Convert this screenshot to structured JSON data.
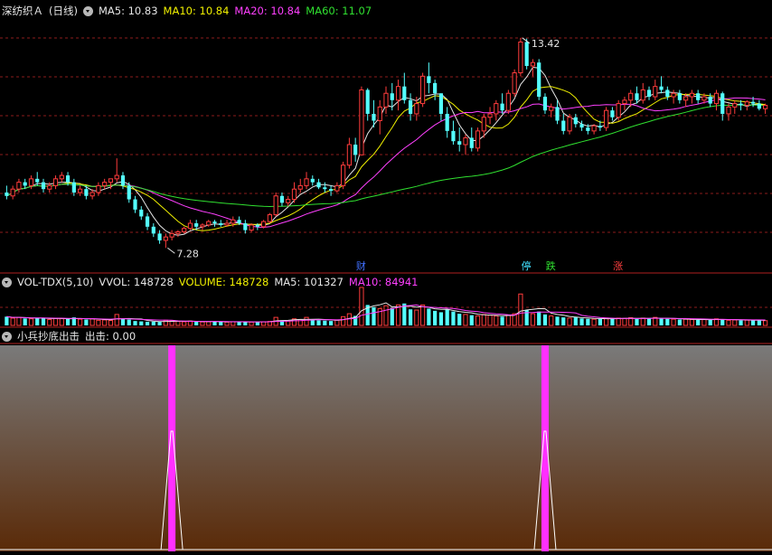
{
  "price_panel": {
    "stock": "深纺织Ａ",
    "period": "(日线)",
    "ma_labels": [
      {
        "text": "MA5: 10.83",
        "color": "#e6e6e6"
      },
      {
        "text": "MA10: 10.84",
        "color": "#f0f000"
      },
      {
        "text": "MA20: 10.84",
        "color": "#ff40ff"
      },
      {
        "text": "MA60: 11.07",
        "color": "#30e030"
      }
    ],
    "high_label": "13.42",
    "low_label": "7.28",
    "event_markers": [
      {
        "text": "财",
        "color": "#4070ff"
      },
      {
        "text": "停",
        "color": "#40e0ff"
      },
      {
        "text": "跌",
        "color": "#30e030"
      },
      {
        "text": "涨",
        "color": "#ff4040"
      }
    ]
  },
  "volume_panel": {
    "name": "VOL-TDX(5,10)",
    "labels": [
      {
        "text": "VVOL: 148728",
        "color": "#e6e6e6"
      },
      {
        "text": "VOLUME: 148728",
        "color": "#f0f000"
      },
      {
        "text": "MA5: 101327",
        "color": "#e6e6e6"
      },
      {
        "text": "MA10: 84941",
        "color": "#ff40ff"
      }
    ]
  },
  "indicator_panel": {
    "name": "小兵抄底出击",
    "label": "出击: 0.00"
  },
  "colors": {
    "up": "#ff3c3c",
    "down": "#54ffff",
    "grid": "#8c1c1c",
    "spike": "#ff30ff"
  },
  "chart_data": [
    {
      "type": "candlestick",
      "title": "深纺织Ａ (日线)",
      "ylim": [
        6.6,
        14.0
      ],
      "candles": [
        [
          8.9,
          9.1,
          8.7,
          8.8
        ],
        [
          8.8,
          9.1,
          8.7,
          9.0
        ],
        [
          9.0,
          9.3,
          8.9,
          9.2
        ],
        [
          9.2,
          9.3,
          9.0,
          9.1
        ],
        [
          9.1,
          9.4,
          9.0,
          9.3
        ],
        [
          9.3,
          9.5,
          9.1,
          9.2
        ],
        [
          9.2,
          9.3,
          8.9,
          9.0
        ],
        [
          9.0,
          9.2,
          8.9,
          9.1
        ],
        [
          9.1,
          9.4,
          9.0,
          9.3
        ],
        [
          9.3,
          9.5,
          9.2,
          9.4
        ],
        [
          9.4,
          9.5,
          9.1,
          9.2
        ],
        [
          9.2,
          9.3,
          8.8,
          8.9
        ],
        [
          8.9,
          9.1,
          8.8,
          9.0
        ],
        [
          9.0,
          9.1,
          8.7,
          8.8
        ],
        [
          8.8,
          9.0,
          8.7,
          8.9
        ],
        [
          8.9,
          9.2,
          8.8,
          9.1
        ],
        [
          9.1,
          9.3,
          9.0,
          9.2
        ],
        [
          9.2,
          9.3,
          9.0,
          9.3
        ],
        [
          9.3,
          9.9,
          9.2,
          9.4
        ],
        [
          9.4,
          9.5,
          9.0,
          9.1
        ],
        [
          9.1,
          9.2,
          8.6,
          8.7
        ],
        [
          8.7,
          8.8,
          8.3,
          8.4
        ],
        [
          8.4,
          8.5,
          8.1,
          8.2
        ],
        [
          8.2,
          8.3,
          7.8,
          7.9
        ],
        [
          7.9,
          8.0,
          7.6,
          7.7
        ],
        [
          7.7,
          7.8,
          7.4,
          7.5
        ],
        [
          7.5,
          7.7,
          7.28,
          7.6
        ],
        [
          7.6,
          7.8,
          7.5,
          7.7
        ],
        [
          7.7,
          7.8,
          7.6,
          7.75
        ],
        [
          7.75,
          7.9,
          7.7,
          7.85
        ],
        [
          7.85,
          8.1,
          7.8,
          8.0
        ],
        [
          8.0,
          8.1,
          7.8,
          7.9
        ],
        [
          7.9,
          8.0,
          7.8,
          7.95
        ],
        [
          7.95,
          8.1,
          7.9,
          8.05
        ],
        [
          8.05,
          8.1,
          7.9,
          8.0
        ],
        [
          8.0,
          8.1,
          7.9,
          7.95
        ],
        [
          7.95,
          8.1,
          7.9,
          8.0
        ],
        [
          8.0,
          8.2,
          7.9,
          8.1
        ],
        [
          8.1,
          8.2,
          7.95,
          8.0
        ],
        [
          8.0,
          8.1,
          7.7,
          7.8
        ],
        [
          7.8,
          8.0,
          7.75,
          7.95
        ],
        [
          7.95,
          8.0,
          7.8,
          7.9
        ],
        [
          7.9,
          8.1,
          7.85,
          8.05
        ],
        [
          8.05,
          8.3,
          8.0,
          8.25
        ],
        [
          8.25,
          8.9,
          8.2,
          8.8
        ],
        [
          8.8,
          8.9,
          8.5,
          8.6
        ],
        [
          8.6,
          8.8,
          8.5,
          8.7
        ],
        [
          8.7,
          9.2,
          8.6,
          9.0
        ],
        [
          9.0,
          9.3,
          8.9,
          9.1
        ],
        [
          9.1,
          9.5,
          9.0,
          9.3
        ],
        [
          9.3,
          9.4,
          9.1,
          9.2
        ],
        [
          9.2,
          9.3,
          9.0,
          9.05
        ],
        [
          9.05,
          9.2,
          8.9,
          9.0
        ],
        [
          9.0,
          9.1,
          8.8,
          8.95
        ],
        [
          8.95,
          9.2,
          8.9,
          9.1
        ],
        [
          9.1,
          9.8,
          9.0,
          9.7
        ],
        [
          9.7,
          10.5,
          9.6,
          10.3
        ],
        [
          10.3,
          10.5,
          9.8,
          10.0
        ],
        [
          10.0,
          12.0,
          10.0,
          11.9
        ],
        [
          11.9,
          11.95,
          11.0,
          11.2
        ],
        [
          11.2,
          11.6,
          10.8,
          11.0
        ],
        [
          11.0,
          11.6,
          10.6,
          11.4
        ],
        [
          11.4,
          12.0,
          11.2,
          11.8
        ],
        [
          11.8,
          12.1,
          11.3,
          11.6
        ],
        [
          11.6,
          12.2,
          11.3,
          12.0
        ],
        [
          12.0,
          12.4,
          11.5,
          11.6
        ],
        [
          11.6,
          11.8,
          11.0,
          11.2
        ],
        [
          11.2,
          11.7,
          11.0,
          11.5
        ],
        [
          11.5,
          12.4,
          11.4,
          12.3
        ],
        [
          12.3,
          12.7,
          11.8,
          12.1
        ],
        [
          12.1,
          12.2,
          11.6,
          11.8
        ],
        [
          11.8,
          11.8,
          11.0,
          11.2
        ],
        [
          11.2,
          11.4,
          10.5,
          10.7
        ],
        [
          10.7,
          11.0,
          10.3,
          10.4
        ],
        [
          10.4,
          10.8,
          10.1,
          10.3
        ],
        [
          10.3,
          10.6,
          10.0,
          10.5
        ],
        [
          10.5,
          10.8,
          10.1,
          10.2
        ],
        [
          10.2,
          10.8,
          10.1,
          10.7
        ],
        [
          10.7,
          11.2,
          10.5,
          11.1
        ],
        [
          11.1,
          11.4,
          10.9,
          11.2
        ],
        [
          11.2,
          11.6,
          11.0,
          11.5
        ],
        [
          11.5,
          11.8,
          11.2,
          11.3
        ],
        [
          11.3,
          11.9,
          11.2,
          11.8
        ],
        [
          11.8,
          12.5,
          11.7,
          12.4
        ],
        [
          12.4,
          13.42,
          12.3,
          13.3
        ],
        [
          13.3,
          13.4,
          12.5,
          12.6
        ],
        [
          12.6,
          12.8,
          12.3,
          12.7
        ],
        [
          12.7,
          12.8,
          11.6,
          11.7
        ],
        [
          11.7,
          11.8,
          11.2,
          11.3
        ],
        [
          11.3,
          11.5,
          11.1,
          11.4
        ],
        [
          11.4,
          11.6,
          10.9,
          11.0
        ],
        [
          11.0,
          11.2,
          10.6,
          10.7
        ],
        [
          10.7,
          11.2,
          10.6,
          11.1
        ],
        [
          11.1,
          11.2,
          10.8,
          10.9
        ],
        [
          10.9,
          11.0,
          10.7,
          10.8
        ],
        [
          10.8,
          10.9,
          10.6,
          10.7
        ],
        [
          10.7,
          10.9,
          10.6,
          10.85
        ],
        [
          10.85,
          11.0,
          10.7,
          10.8
        ],
        [
          10.8,
          11.4,
          10.7,
          11.3
        ],
        [
          11.3,
          11.4,
          11.0,
          11.1
        ],
        [
          11.1,
          11.6,
          11.0,
          11.5
        ],
        [
          11.5,
          11.7,
          11.3,
          11.6
        ],
        [
          11.6,
          11.9,
          11.4,
          11.8
        ],
        [
          11.8,
          12.0,
          11.5,
          11.6
        ],
        [
          11.6,
          12.1,
          11.5,
          11.9
        ],
        [
          11.9,
          12.0,
          11.6,
          11.7
        ],
        [
          11.7,
          12.2,
          11.6,
          12.0
        ],
        [
          12.0,
          12.3,
          11.8,
          11.9
        ],
        [
          11.9,
          12.0,
          11.6,
          11.7
        ],
        [
          11.7,
          11.9,
          11.5,
          11.8
        ],
        [
          11.8,
          11.9,
          11.5,
          11.6
        ],
        [
          11.6,
          11.8,
          11.4,
          11.7
        ],
        [
          11.7,
          11.9,
          11.5,
          11.8
        ],
        [
          11.8,
          11.9,
          11.5,
          11.6
        ],
        [
          11.6,
          11.8,
          11.5,
          11.7
        ],
        [
          11.7,
          11.8,
          11.4,
          11.5
        ],
        [
          11.5,
          11.9,
          11.3,
          11.8
        ],
        [
          11.8,
          11.85,
          11.0,
          11.2
        ],
        [
          11.2,
          11.5,
          11.0,
          11.4
        ],
        [
          11.4,
          11.6,
          11.2,
          11.5
        ],
        [
          11.5,
          11.6,
          11.3,
          11.45
        ],
        [
          11.45,
          11.6,
          11.3,
          11.55
        ],
        [
          11.55,
          11.7,
          11.4,
          11.5
        ],
        [
          11.5,
          11.6,
          11.3,
          11.35
        ],
        [
          11.35,
          11.5,
          11.2,
          11.45
        ]
      ],
      "events": [
        {
          "index": 58,
          "label": "财"
        },
        {
          "index": 85,
          "label": "停"
        },
        {
          "index": 89,
          "label": "跌"
        },
        {
          "index": 100,
          "label": "涨"
        }
      ]
    },
    {
      "type": "bar",
      "title": "VOL-TDX(5,10)",
      "ylim": [
        0,
        520000
      ],
      "values": [
        120000,
        100000,
        110000,
        95000,
        90000,
        105000,
        100000,
        80000,
        95000,
        92000,
        88000,
        110000,
        85000,
        80000,
        90000,
        70000,
        75000,
        68000,
        150000,
        95000,
        80000,
        60000,
        55000,
        50000,
        52000,
        48000,
        70000,
        60000,
        55000,
        50000,
        60000,
        52000,
        48000,
        50000,
        55000,
        48000,
        45000,
        50000,
        52000,
        47000,
        45000,
        48000,
        50000,
        55000,
        110000,
        70000,
        60000,
        90000,
        80000,
        110000,
        75000,
        70000,
        65000,
        60000,
        75000,
        120000,
        160000,
        130000,
        520000,
        280000,
        250000,
        230000,
        270000,
        240000,
        280000,
        300000,
        220000,
        210000,
        280000,
        230000,
        200000,
        180000,
        220000,
        190000,
        160000,
        150000,
        140000,
        130000,
        150000,
        140000,
        130000,
        120000,
        140000,
        160000,
        430000,
        210000,
        160000,
        190000,
        150000,
        130000,
        120000,
        110000,
        100000,
        110000,
        95000,
        90000,
        85000,
        90000,
        100000,
        90000,
        100000,
        95000,
        105000,
        90000,
        100000,
        95000,
        110000,
        95000,
        90000,
        85000,
        80000,
        85000,
        80000,
        75000,
        80000,
        75000,
        90000,
        85000,
        70000,
        75000,
        70000,
        72000,
        68000,
        70000,
        65000
      ]
    },
    {
      "type": "line",
      "title": "小兵抄底出击",
      "series": [
        {
          "name": "出击",
          "spikes_at_index": [
            27,
            88
          ],
          "value": 0.0
        }
      ]
    }
  ]
}
